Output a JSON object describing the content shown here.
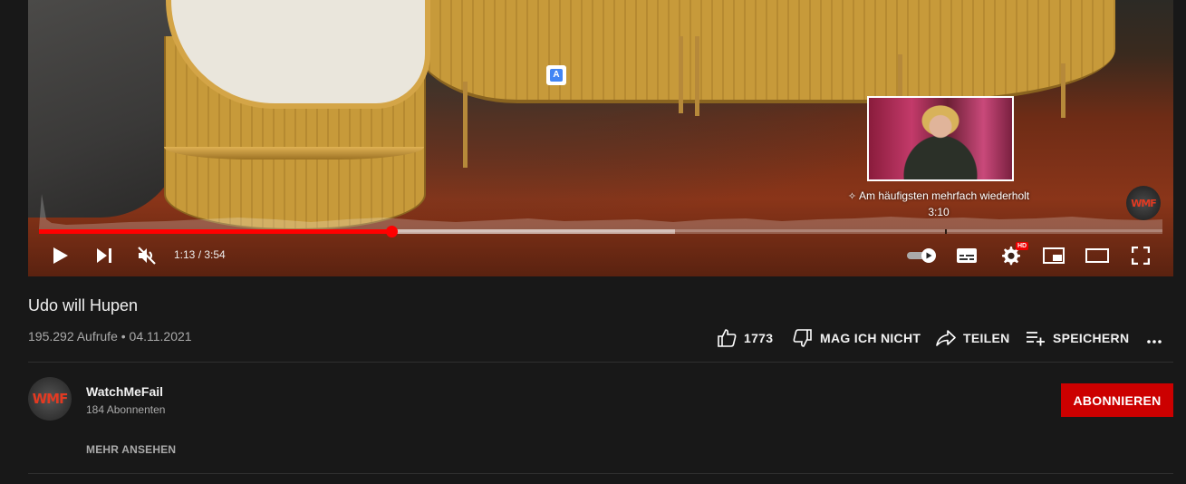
{
  "video": {
    "title": "Udo will Hupen",
    "views_date": "195.292 Aufrufe • 04.11.2021",
    "progress": {
      "played_fraction": 0.314,
      "buffered_fraction": 0.566
    }
  },
  "player": {
    "time": "1:13 / 3:54",
    "preview_label": "Am häufigsten mehrfach wiederholt",
    "preview_time": "3:10",
    "settings_badge": "HD",
    "translate_badge": "A",
    "watermark": "WMF",
    "icons": [
      "play-icon",
      "next-icon",
      "mute-icon",
      "autoplay-toggle-icon",
      "subtitles-icon",
      "gear-icon",
      "miniplayer-icon",
      "theater-icon",
      "fullscreen-icon"
    ]
  },
  "actions": {
    "like_count": "1773",
    "dislike_label": "MAG ICH NICHT",
    "share_label": "TEILEN",
    "save_label": "SPEICHERN"
  },
  "channel": {
    "name": "WatchMeFail",
    "subscribers": "184 Abonnenten",
    "subscribe_label": "ABONNIEREN",
    "more_label": "MEHR ANSEHEN",
    "avatar_text": "WMF"
  },
  "colors": {
    "accent_red": "#ff0000",
    "subscribe_bg": "#cc0000",
    "page_bg": "#181818"
  }
}
